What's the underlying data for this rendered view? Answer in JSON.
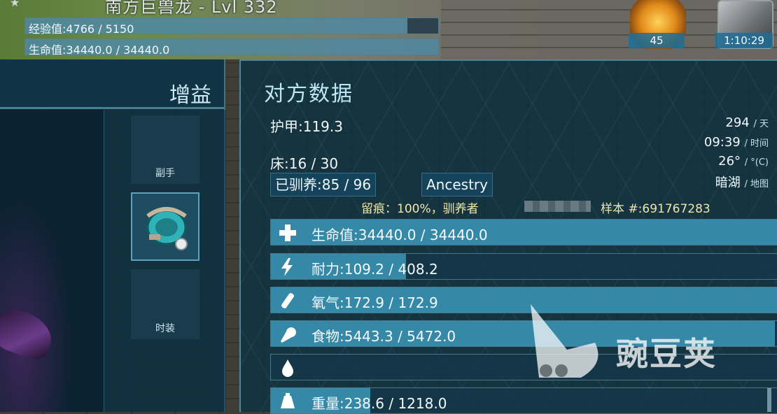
{
  "top": {
    "dino_name": "南方巨兽龙 - Lvl 332",
    "xp_text": "经验值:4766 / 5150",
    "xp_fraction": 0.925,
    "health_text": "生命值:34440.0 / 34440.0",
    "health_fraction": 1.0,
    "resource_count": "45",
    "timer": "1:10:29"
  },
  "left_panel": {
    "buffs_title": "增益",
    "slots": [
      {
        "label": "副手"
      },
      {
        "label": ""
      },
      {
        "label": "时装"
      }
    ]
  },
  "right_panel": {
    "title": "对方数据",
    "armor": "护甲:119.3",
    "bed": "床:16 / 30",
    "tamed": "已驯养:85 / 96",
    "ancestry_button": "Ancestry",
    "imprint": "留痕：100%，驯养者",
    "specimen": "样本 #:691767283",
    "info": {
      "day": "294",
      "day_unit": "/ 天",
      "time": "09:39",
      "time_unit": "/ 时间",
      "temp": "26°",
      "temp_unit": "/ °(C)",
      "location": "暗湖",
      "location_unit": "/ 地图"
    },
    "bars": [
      {
        "icon": "health-cross-icon",
        "text": "生命值:34440.0 / 34440.0",
        "fraction": 1.0
      },
      {
        "icon": "stamina-lightning-icon",
        "text": "耐力:109.2 / 408.2",
        "fraction": 0.267
      },
      {
        "icon": "oxygen-tank-icon",
        "text": "氧气:172.9 / 172.9",
        "fraction": 1.0
      },
      {
        "icon": "food-drumstick-icon",
        "text": "食物:5443.3 / 5472.0",
        "fraction": 0.995
      },
      {
        "icon": "water-drop-icon",
        "text": "",
        "fraction": 0.0
      },
      {
        "icon": "weight-icon",
        "text": "重量:238.6 / 1218.0",
        "fraction": 0.196
      }
    ]
  },
  "watermark": "豌豆荚"
}
